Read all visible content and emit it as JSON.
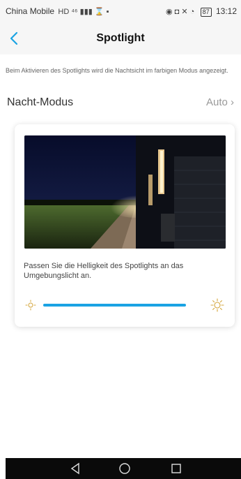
{
  "status_bar": {
    "carrier": "China Mobile",
    "left_icons": "HD ⁴⁶ ▮▮▮ ⌛ ▪",
    "right_icons": "◉ ◘ ✕ ◔",
    "battery": "87",
    "time": "13:12"
  },
  "header": {
    "title": "Spotlight"
  },
  "info_text": "Beim Aktivieren des Spotlights wird die Nachtsicht im farbigen Modus angezeigt.",
  "night_mode": {
    "label": "Nacht-Modus",
    "value": "Auto",
    "chevron": "›"
  },
  "card": {
    "description": "Passen Sie die Helligkeit des Spotlights an das Umgebungslicht an.",
    "slider_level": 1.0
  },
  "colors": {
    "accent": "#1aa3e3"
  },
  "icons": {
    "back": "chevron-left-icon",
    "brightness_low": "sun-low-icon",
    "brightness_high": "sun-high-icon",
    "nav_back": "triangle-back-icon",
    "nav_home": "circle-home-icon",
    "nav_recent": "square-recent-icon"
  }
}
